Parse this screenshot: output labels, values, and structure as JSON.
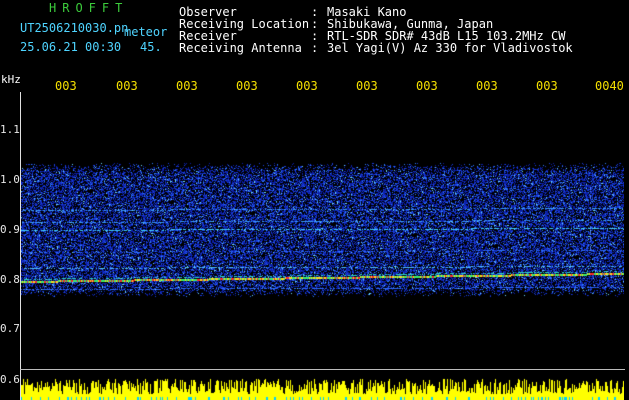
{
  "header": {
    "brand": "HROFFT",
    "filename": "UT2506210030.pn",
    "mode_label": "meteor",
    "datetime": "25.06.21 00:30",
    "count": "45.",
    "meta": [
      {
        "label": "Observer",
        "value": "Masaki Kano"
      },
      {
        "label": "Receiving Location",
        "value": "Shibukawa, Gunma, Japan"
      },
      {
        "label": "Receiver",
        "value": "RTL-SDR SDR# 43dB L15 103.2MHz CW"
      },
      {
        "label": "Receiving Antenna",
        "value": "3el Yagi(V) Az 330 for Vladivostok"
      }
    ],
    "separator": ":"
  },
  "axis": {
    "unit": "kHz",
    "y_ticks": [
      "1.1",
      "1.0",
      "0.9",
      "0.8",
      "0.7",
      "0.6"
    ],
    "time_ticks": [
      "003",
      "003",
      "003",
      "003",
      "003",
      "003",
      "003",
      "003",
      "003",
      "0040"
    ]
  },
  "colors": {
    "background": "#000000",
    "header_green": "#3ccc3c",
    "header_cyan": "#4fd4ff",
    "time_yellow": "#f5e000",
    "noise_blue": "#1030c0",
    "signal_red": "#ff2020",
    "amplitude_yellow": "#ffff00"
  }
}
